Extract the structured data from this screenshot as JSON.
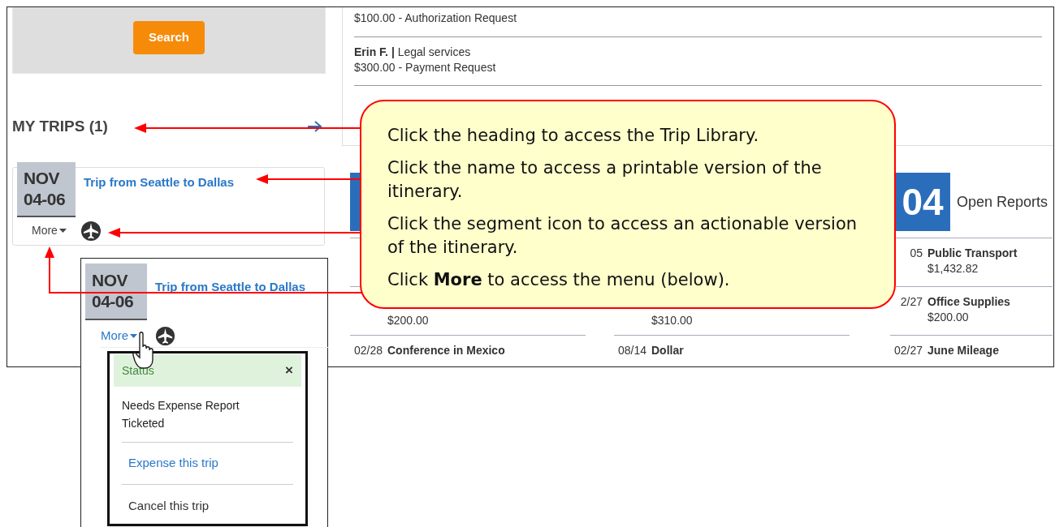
{
  "search_button": "Search",
  "my_trips": {
    "heading": "MY TRIPS (1)"
  },
  "trip_card": {
    "month": "NOV",
    "dates": "04-06",
    "title": "Trip from Seattle to Dallas",
    "more": "More"
  },
  "requests": [
    {
      "amount": "$100.00 - Authorization Request"
    },
    {
      "person": "Erin F. |",
      "description": "Legal services",
      "amount": "$300.00 - Payment Request"
    }
  ],
  "columns": [
    {
      "rows": [
        {
          "amount": "$200.00"
        },
        {
          "date": "02/28",
          "name": "Conference in Mexico"
        }
      ]
    },
    {
      "rows": [
        {
          "amount": "$310.00"
        },
        {
          "date": "08/14",
          "name": "Dollar"
        }
      ]
    },
    {
      "count": "04",
      "title": "Open Reports",
      "rows": [
        {
          "date": "05",
          "name": "Public Transport",
          "amount": "$1,432.82"
        },
        {
          "date": "2/27",
          "name": "Office Supplies",
          "amount": "$200.00"
        },
        {
          "date": "02/27",
          "name": "June Mileage"
        }
      ]
    }
  ],
  "zoomed_trip": {
    "month": "NOV",
    "dates": "04-06",
    "title": "Trip from Seattle to Dallas",
    "more": "More"
  },
  "menu": {
    "header": "Status",
    "close": "×",
    "status_lines": [
      "Needs Expense Report",
      "Ticketed"
    ],
    "actions": [
      {
        "label": "Expense this trip",
        "kind": "link"
      },
      {
        "label": "Cancel this trip",
        "kind": "plain"
      }
    ]
  },
  "callout": {
    "paragraphs": [
      "Click the heading to access the Trip Library.",
      "Click the name to access a printable version of the itinerary.",
      "Click the segment icon to access an actionable version of the itinerary.",
      "Click **More** to access the menu (below)."
    ]
  }
}
